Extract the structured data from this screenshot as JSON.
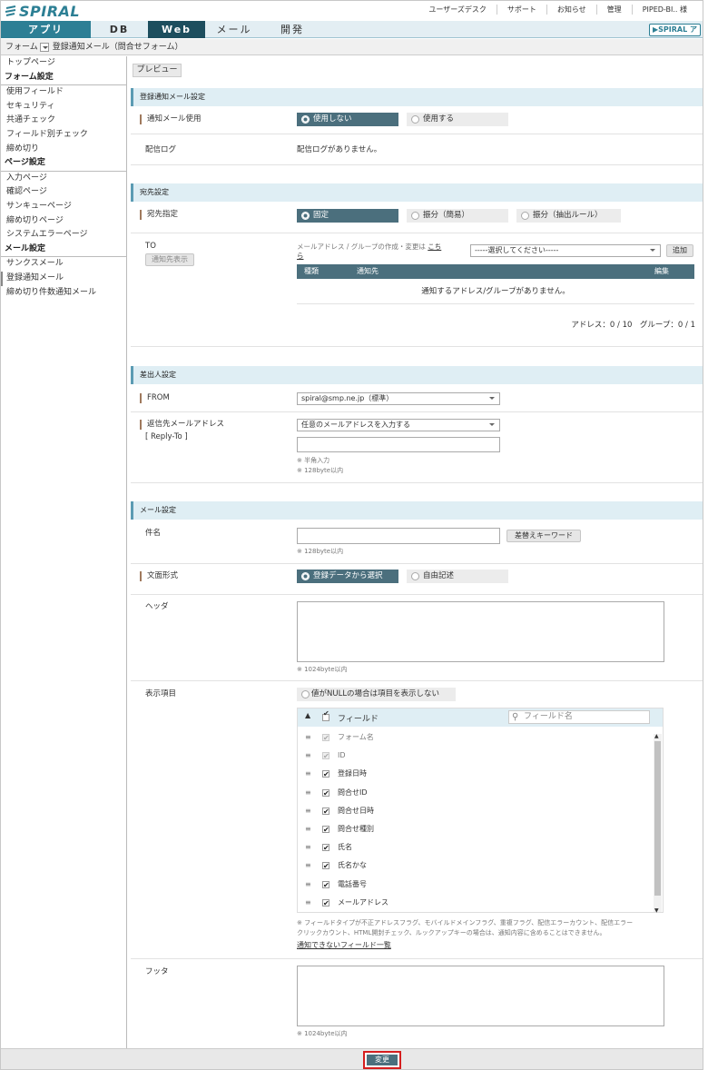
{
  "brand": {
    "logo": "SPIRAL",
    "button": "▶SPIRAL ア"
  },
  "toplinks": [
    "ユーザーズデスク",
    "サポート",
    "お知らせ",
    "管理",
    "PIPED-BI.. 様"
  ],
  "nav": {
    "tabs": [
      "アプリ",
      "DB",
      "Web",
      "メール",
      "開発"
    ]
  },
  "breadcrumb": {
    "root": "フォーム",
    "current": "登録通知メール（問合せフォーム）"
  },
  "sidebar": {
    "top": "トップページ",
    "form_head": "フォーム設定",
    "form_items": [
      "使用フィールド",
      "セキュリティ",
      "共通チェック",
      "フィールド別チェック",
      "締め切り"
    ],
    "page_head": "ページ設定",
    "page_items": [
      "入力ページ",
      "確認ページ",
      "サンキューページ",
      "締め切りページ",
      "システムエラーページ"
    ],
    "mail_head": "メール設定",
    "mail_items": [
      "サンクスメール",
      "登録通知メール",
      "締め切り件数通知メール"
    ]
  },
  "preview": "プレビュー",
  "sec1": {
    "title": "登録通知メール設定",
    "usage_label": "通知メール使用",
    "usage_off": "使用しない",
    "usage_on": "使用する",
    "log_label": "配信ログ",
    "log_value": "配信ログがありません。"
  },
  "sec2": {
    "title": "宛先設定",
    "dest_label": "宛先指定",
    "dest_fixed": "固定",
    "dest_simple": "振分（簡易）",
    "dest_rule": "振分（抽出ルール）",
    "to_label": "TO",
    "show_btn": "通知先表示",
    "note": "メールアドレス / グループの作成・変更は",
    "note_link1": "こち",
    "note_link2": "ら",
    "select": "-----選択してください-----",
    "add_btn": "追加",
    "col_type": "種類",
    "col_dest": "通知先",
    "col_edit": "編集",
    "empty": "通知するアドレス/グループがありません。",
    "count": "アドレス：0 / 10　グループ：0 / 1"
  },
  "sec3": {
    "title": "差出人設定",
    "from_label": "FROM",
    "from_value": "spiral@smp.ne.jp（標準）",
    "reply_label": "返信先メールアドレス",
    "reply_sub": "[ Reply-To ]",
    "reply_value": "任意のメールアドレスを入力する",
    "hint1": "※ 半角入力",
    "hint2": "※ 128byte以内"
  },
  "sec4": {
    "title": "メール設定",
    "subject_label": "件名",
    "subject_hint": "※ 128byte以内",
    "keyword_btn": "差替えキーワード",
    "format_label": "文面形式",
    "format_reg": "登録データから選択",
    "format_free": "自由記述",
    "header_label": "ヘッダ",
    "header_hint": "※ 1024byte以内",
    "items_label": "表示項目",
    "null_check": "値がNULLの場合は項目を表示しない",
    "field_head": "フィールド",
    "field_search": "フィールド名",
    "fields": [
      {
        "name": "フォーム名",
        "state": "dis"
      },
      {
        "name": "ID",
        "state": "dis"
      },
      {
        "name": "登録日時",
        "state": "on"
      },
      {
        "name": "問合せID",
        "state": "on"
      },
      {
        "name": "問合せ日時",
        "state": "on"
      },
      {
        "name": "問合せ種別",
        "state": "on"
      },
      {
        "name": "氏名",
        "state": "on"
      },
      {
        "name": "氏名かな",
        "state": "on"
      },
      {
        "name": "電話番号",
        "state": "on"
      },
      {
        "name": "メールアドレス",
        "state": "on"
      }
    ],
    "field_note1": "※ フィールドタイプが不正アドレスフラグ、モバイルドメインフラグ、重複フラグ、配信エラーカウント、配信エラー",
    "field_note2": "クリックカウント、HTML開封チェック、ルックアップキーの場合は、通知内容に含めることはできません。",
    "field_link": "通知できないフィールド一覧",
    "footer_label": "フッタ",
    "footer_hint": "※ 1024byte以内"
  },
  "save": "変更"
}
